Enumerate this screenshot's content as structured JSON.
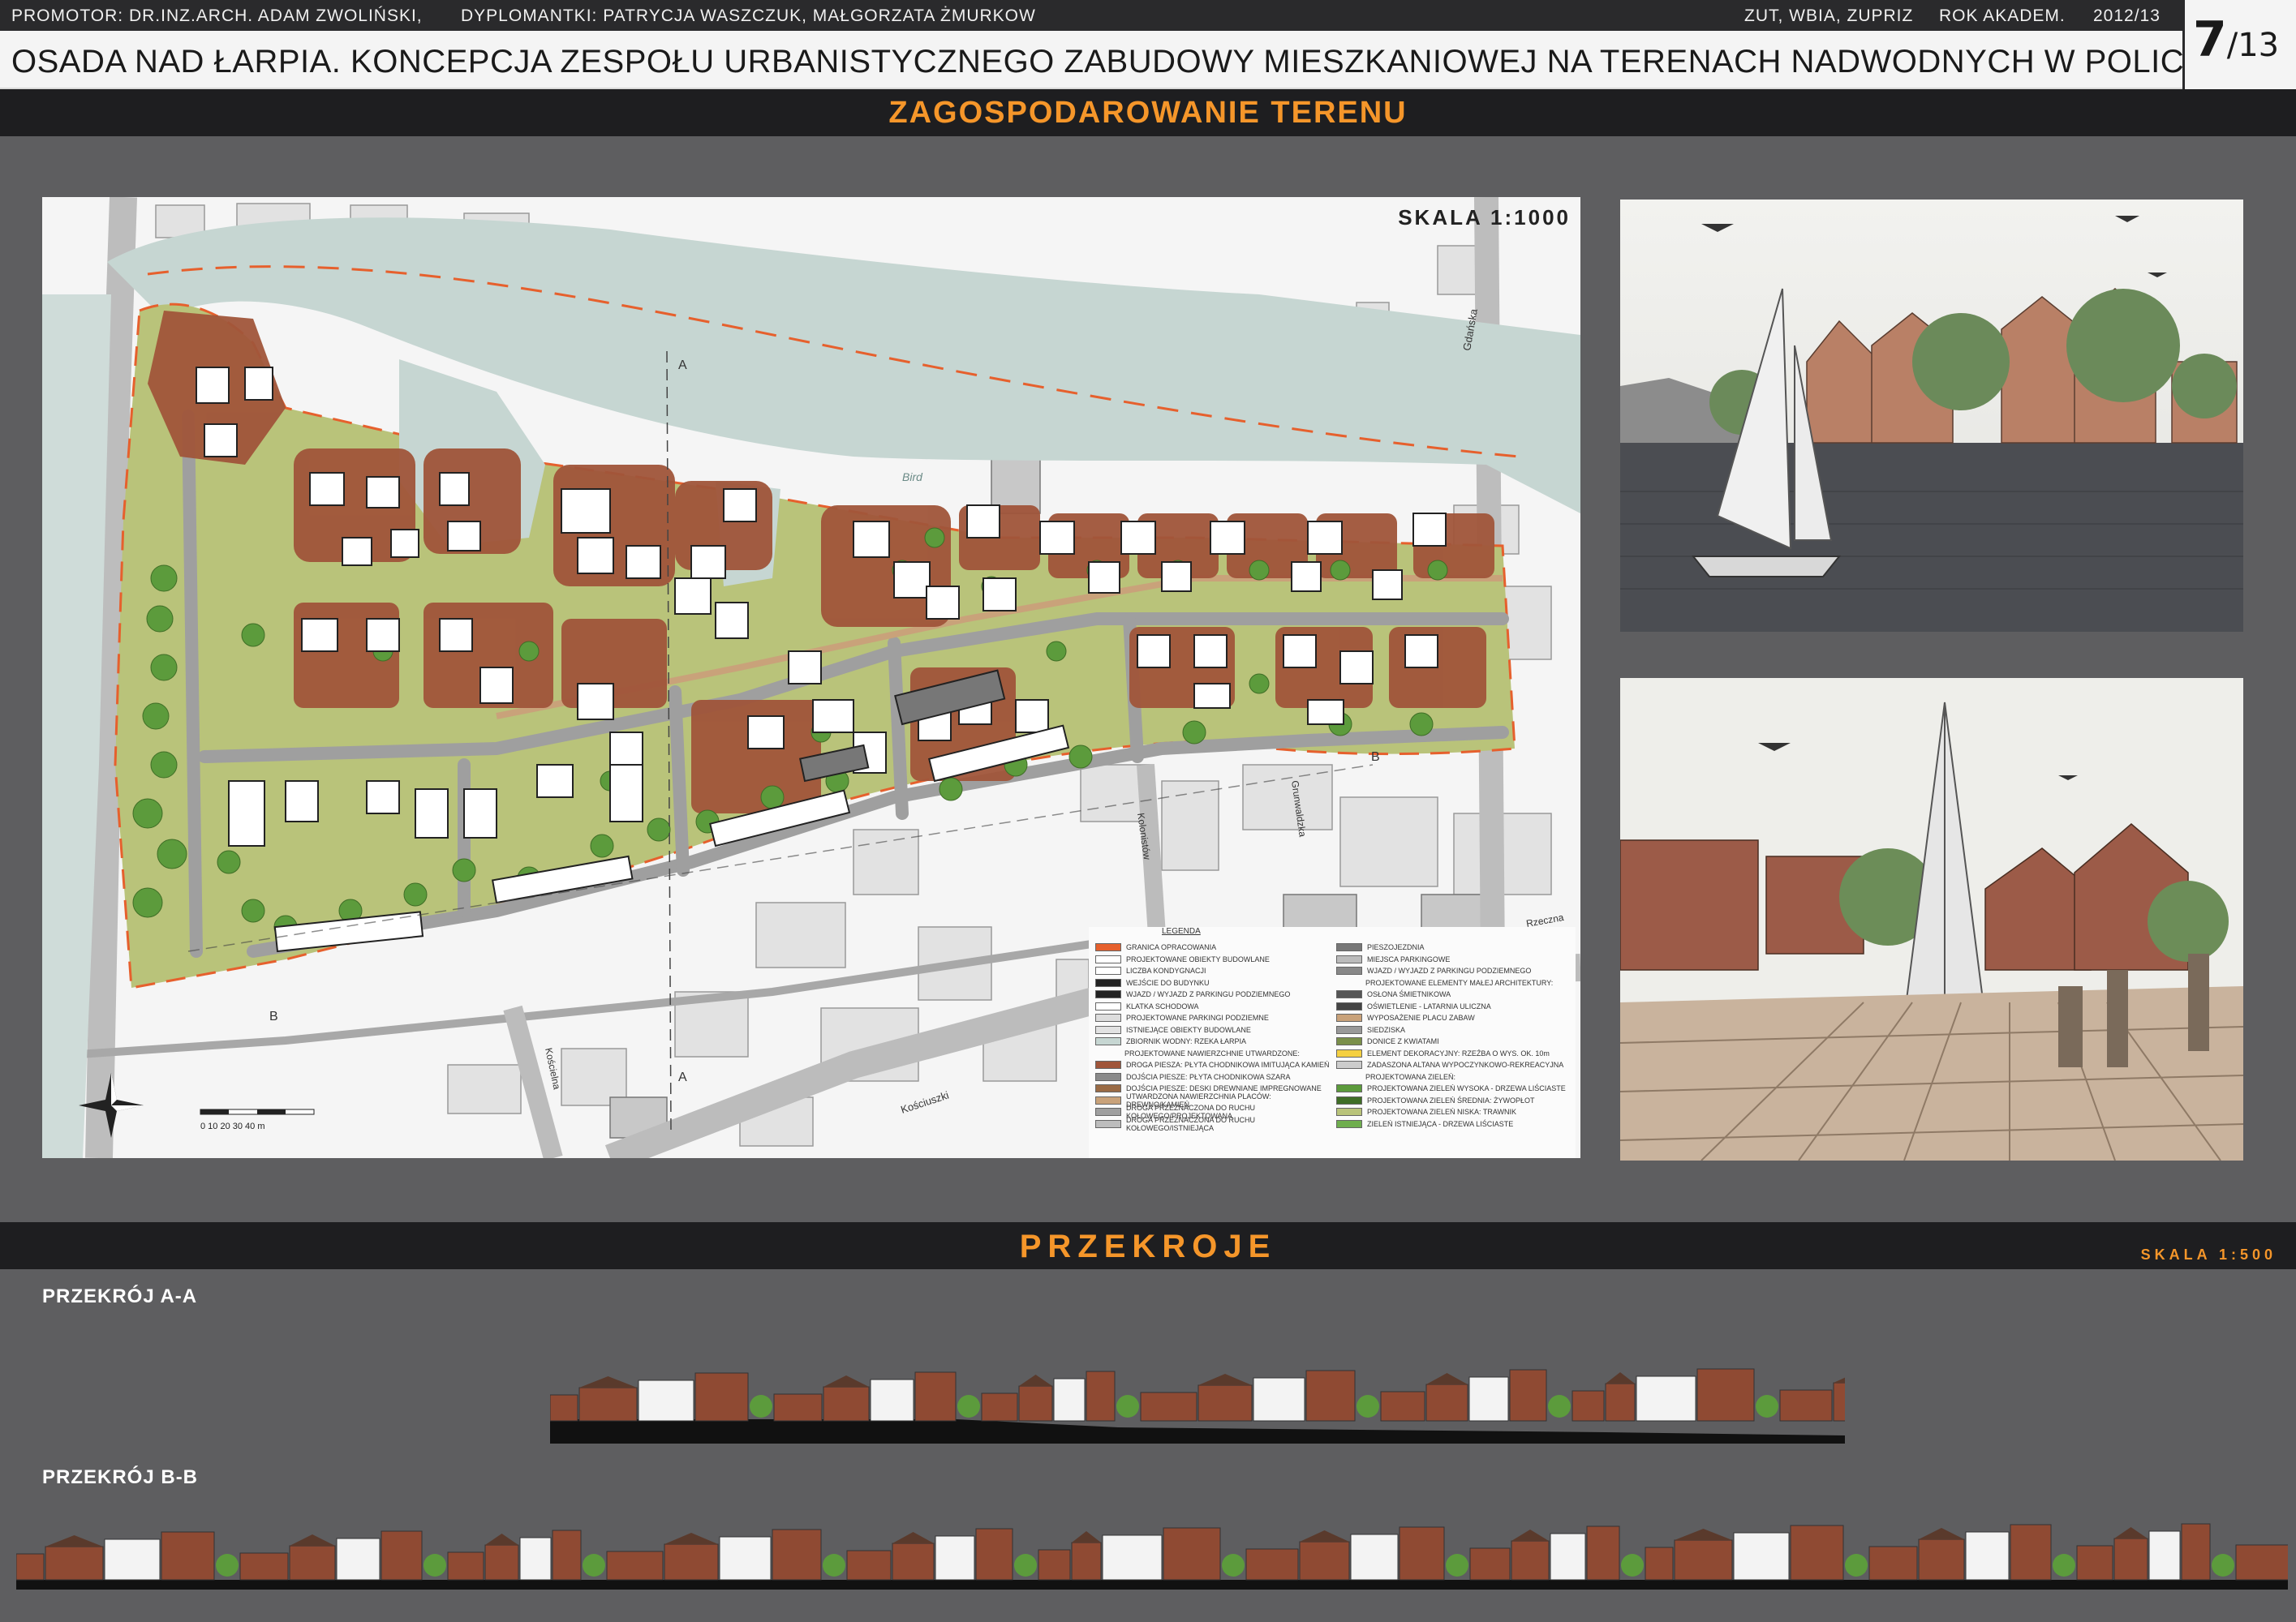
{
  "header": {
    "promotor": "PROMOTOR: DR.INZ.ARCH. ADAM ZWOLIŃSKI,",
    "diplomants": "DYPLOMANTKI: PATRYCJA WASZCZUK, MAŁGORZATA ŻMURKOW",
    "institution": "ZUT, WBIA, ZUPRIZ",
    "year_label": "ROK AKADEM.",
    "year": "2012/13",
    "title": "OSADA NAD ŁARPIA. KONCEPCJA ZESPOŁU  URBANISTYCZNEGO  ZABUDOWY MIESZKANIOWEJ NA TERENACH NADWODNYCH W POLICACH.",
    "page_number": "7",
    "page_total": "/13"
  },
  "sections": {
    "site_plan": "ZAGOSPODAROWANIE TERENU",
    "cross_sections": "PRZEKROJE",
    "cross_scale": "SKALA 1:500"
  },
  "site_plan": {
    "scale": "SKALA 1:1000",
    "section_marker_a": "A",
    "section_marker_b": "B",
    "scale_bar": "0  10  20  30  40 m",
    "river_label": "Bird",
    "street_labels": [
      "Kościuszki",
      "Gdańska",
      "Kolonistów",
      "Kościelna",
      "Grunwaldzka",
      "Rzeczna"
    ],
    "legend_title": "LEGENDA",
    "legend_left": [
      "GRANICA OPRACOWANIA",
      "PROJEKTOWANE OBIEKTY BUDOWLANE",
      "LICZBA KONDYGNACJI",
      "WEJŚCIE DO BUDYNKU",
      "WJAZD / WYJAZD Z PARKINGU PODZIEMNEGO",
      "KLATKA SCHODOWA",
      "PROJEKTOWANE PARKINGI PODZIEMNE",
      "ISTNIEJĄCE OBIEKTY BUDOWLANE",
      "ZBIORNIK WODNY: RZEKA ŁARPIA",
      "PROJEKTOWANE NAWIERZCHNIE UTWARDZONE:",
      "DROGA PIESZA: PŁYTA CHODNIKOWA IMITUJĄCA KAMIEŃ",
      "DOJŚCIA PIESZE: PŁYTA CHODNIKOWA SZARA",
      "DOJŚCIA PIESZE: DESKI DREWNIANE IMPREGNOWANE",
      "UTWARDZONA NAWIERZCHNIA PLACÓW: DREWNO/KAMIEŃ",
      "DROGA PRZEZNACZONA DO RUCHU KOŁOWEGO/PROJEKTOWANA",
      "DROGA PRZEZNACZONA DO RUCHU KOŁOWEGO/ISTNIEJĄCA"
    ],
    "legend_right": [
      "PIESZOJEZDNIA",
      "MIEJSCA PARKINGOWE",
      "WJAZD / WYJAZD Z PARKINGU PODZIEMNEGO",
      "PROJEKTOWANE ELEMENTY MAŁEJ ARCHITEKTURY:",
      "OSŁONA ŚMIETNIKOWA",
      "OŚWIETLENIE - LATARNIA ULICZNA",
      "WYPOSAŻENIE PLACU ZABAW",
      "SIEDZISKA",
      "DONICE Z KWIATAMI",
      "ELEMENT DEKORACYJNY: RZEŹBA O WYS. OK. 10m",
      "ZADASZONA ALTANA WYPOCZYNKOWO-REKREACYJNA",
      "PROJEKTOWANA ZIELEŃ:",
      "PROJEKTOWANA ZIELEŃ WYSOKA - DRZEWA LIŚCIASTE",
      "PROJEKTOWANA ZIELEŃ ŚREDNIA: ŻYWOPŁOT",
      "PROJEKTOWANA ZIELEŃ NISKA: TRAWNIK",
      "ZIELEŃ ISTNIEJĄCA - DRZEWA LIŚCIASTE"
    ]
  },
  "cross_sections": {
    "a_label": "PRZEKRÓJ A-A",
    "b_label": "PRZEKRÓJ B-B"
  },
  "colors": {
    "accent_orange": "#f5962a",
    "background": "#5e5e60",
    "band": "#1e1e20",
    "brick": "#a0553a",
    "lawn": "#b9c37a",
    "water": "#c6d6d2"
  }
}
